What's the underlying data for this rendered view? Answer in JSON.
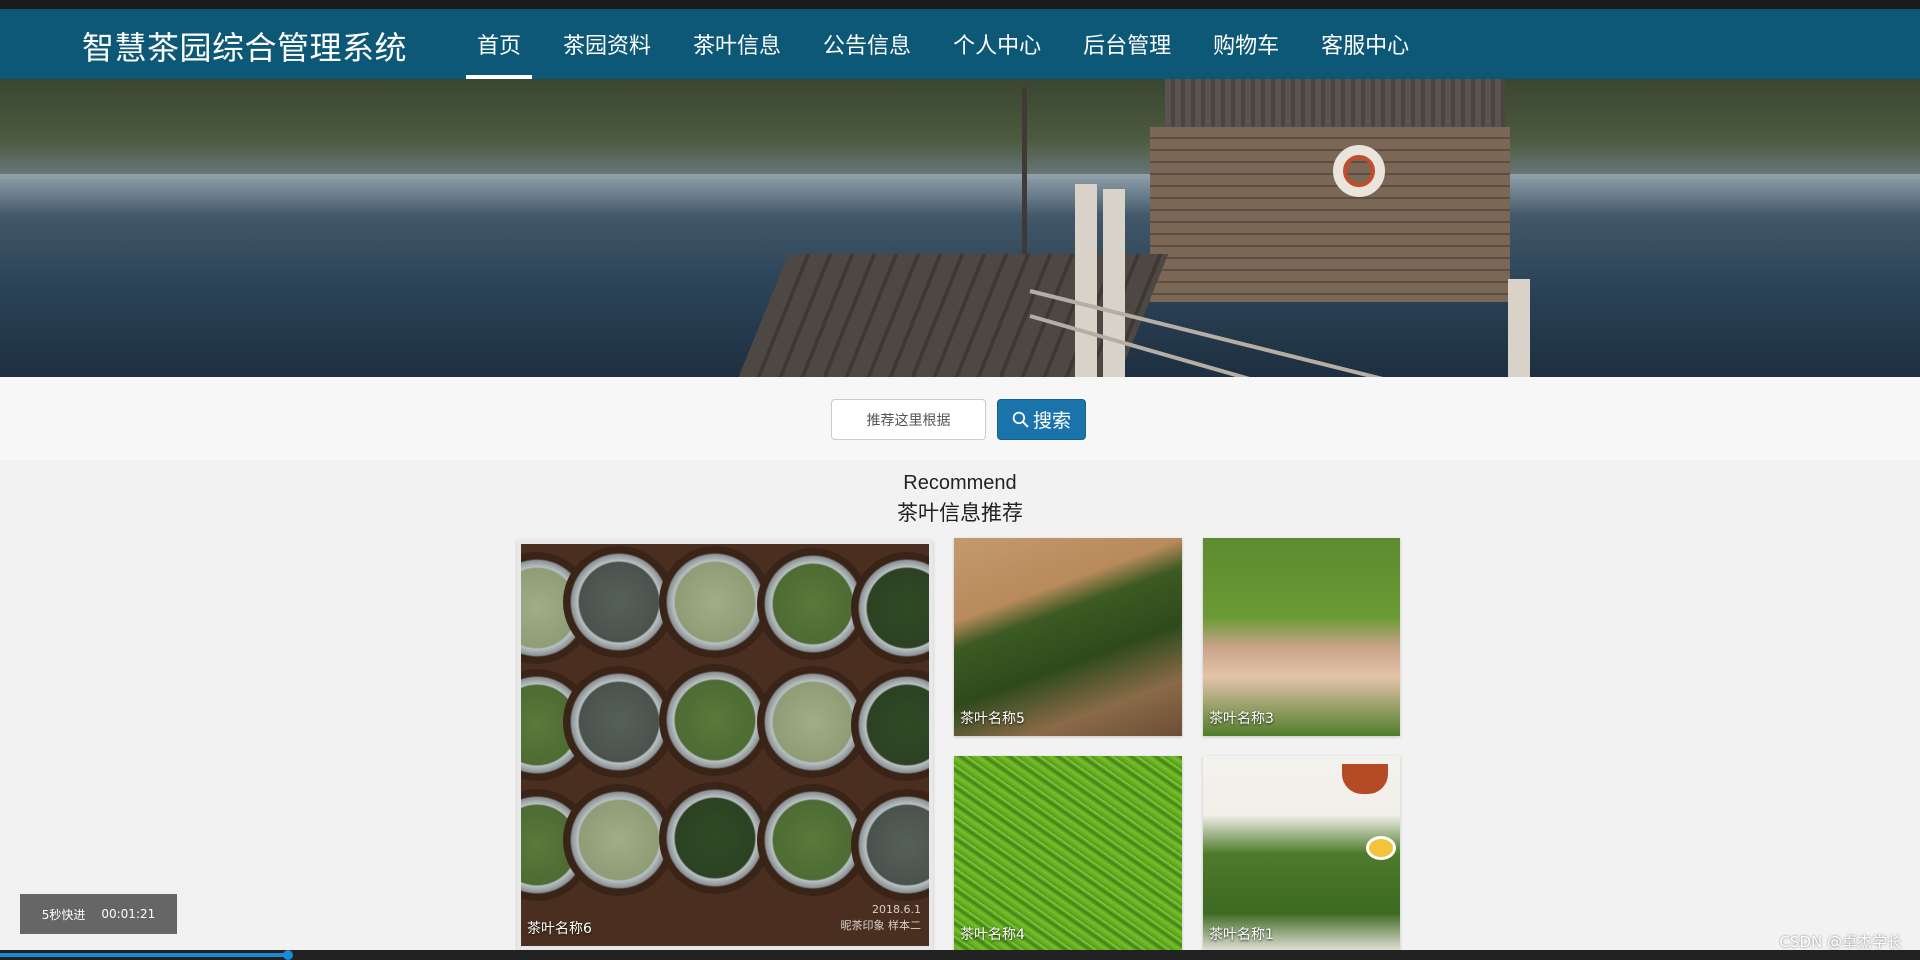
{
  "app": {
    "title": "智慧茶园综合管理系统"
  },
  "nav": {
    "items": [
      {
        "label": "首页",
        "active": true
      },
      {
        "label": "茶园资料",
        "active": false
      },
      {
        "label": "茶叶信息",
        "active": false
      },
      {
        "label": "公告信息",
        "active": false
      },
      {
        "label": "个人中心",
        "active": false
      },
      {
        "label": "后台管理",
        "active": false
      },
      {
        "label": "购物车",
        "active": false
      },
      {
        "label": "客服中心",
        "active": false
      }
    ]
  },
  "banner": {
    "slides": 3,
    "active_slide": 2
  },
  "search": {
    "value": "推荐这里根据",
    "button_label": "搜索",
    "icon": "search-icon"
  },
  "section": {
    "title_en": "Recommend",
    "title_zh": "茶叶信息推荐"
  },
  "recommend": [
    {
      "name": "茶叶名称6"
    },
    {
      "name": "茶叶名称5"
    },
    {
      "name": "茶叶名称3"
    },
    {
      "name": "茶叶名称4"
    },
    {
      "name": "茶叶名称1"
    }
  ],
  "tile6_stamp": {
    "date": "2018.6.1",
    "text": "昵茶印象 样本二"
  },
  "video": {
    "fast_forward": "5秒快进",
    "time": "00:01:21",
    "progress": 0.15
  },
  "watermark": "CSDN @卓杰学长",
  "colors": {
    "navbar": "#0d5877",
    "search_button": "#1a74ab",
    "progress": "#1a8ad4"
  }
}
